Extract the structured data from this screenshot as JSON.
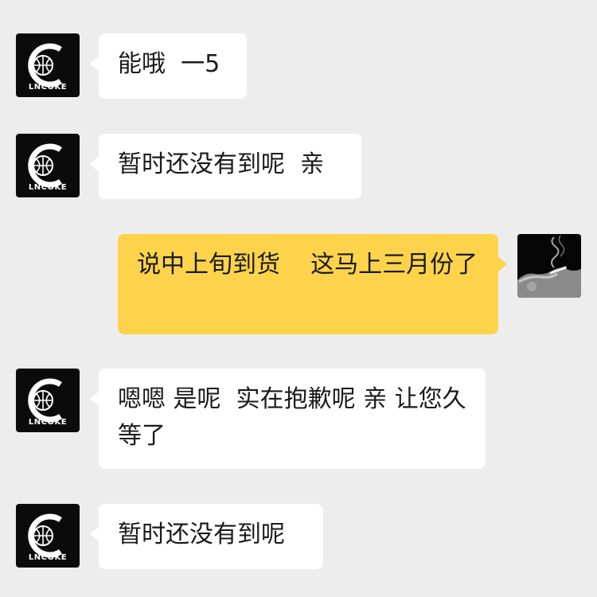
{
  "brand": {
    "logo_text": "LNCOKE",
    "accent": "#ffffff",
    "background": "#0b0b0b"
  },
  "colors": {
    "page_background": "#ededed",
    "incoming_bubble": "#ffffff",
    "outgoing_bubble": "#fcd34a",
    "text": "#1a1a1a"
  },
  "messages": [
    {
      "sender": "shop",
      "side": "left",
      "text": "能哦  一5"
    },
    {
      "sender": "shop",
      "side": "left",
      "text": "暂时还没有到呢  亲"
    },
    {
      "sender": "me",
      "side": "right",
      "text": "说中上旬到货    这马上三月份了"
    },
    {
      "sender": "shop",
      "side": "left",
      "text": "嗯嗯 是呢  实在抱歉呢 亲 让您久等了"
    },
    {
      "sender": "shop",
      "side": "left",
      "text": "暂时还没有到呢"
    }
  ],
  "avatars": {
    "shop_icon": "basketball-c-logo-icon",
    "user_icon": "smoking-portrait-icon"
  }
}
